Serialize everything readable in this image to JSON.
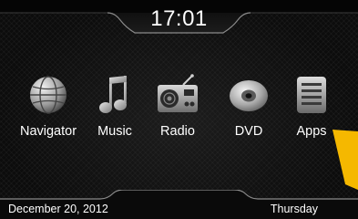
{
  "status": {
    "clock": "17:01",
    "date": "December 20, 2012",
    "weekday": "Thursday"
  },
  "apps": [
    {
      "label": "Navigator",
      "icon": "globe-icon"
    },
    {
      "label": "Music",
      "icon": "music-note-icon"
    },
    {
      "label": "Radio",
      "icon": "radio-icon"
    },
    {
      "label": "DVD",
      "icon": "disc-icon"
    },
    {
      "label": "Apps",
      "icon": "apps-list-icon"
    }
  ],
  "colors": {
    "background": "#0c0c0c",
    "text": "#ffffff",
    "pointer": "#f5b800",
    "bar_line": "#8a8a8a"
  }
}
